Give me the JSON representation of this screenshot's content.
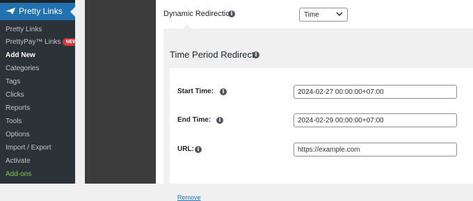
{
  "sidebar": {
    "header": "Pretty Links",
    "items": [
      {
        "label": "Pretty Links"
      },
      {
        "label": "PrettyPay™ Links",
        "badge": "NEW"
      },
      {
        "label": "Add New",
        "current": true
      },
      {
        "label": "Categories"
      },
      {
        "label": "Tags"
      },
      {
        "label": "Clicks"
      },
      {
        "label": "Reports"
      },
      {
        "label": "Tools"
      },
      {
        "label": "Options"
      },
      {
        "label": "Import / Export"
      },
      {
        "label": "Activate"
      },
      {
        "label": "Add-ons"
      }
    ]
  },
  "redirection": {
    "label": "Dynamic Redirection",
    "selected": "Time"
  },
  "time_period": {
    "title": "Time Period Redirects",
    "start_label": "Start Time:",
    "start_value": "2024-02-27 00:00:00+07:00",
    "end_label": "End Time:",
    "end_value": "2024-02-29 00:00:00+07:00",
    "url_label": "URL:",
    "url_value": "https://example.com",
    "remove_label": "Remove"
  },
  "colors": {
    "admin_blue": "#2271b1",
    "sidebar_bg": "#1d2327",
    "badge_red": "#d63638",
    "link_blue": "#2271b1"
  }
}
